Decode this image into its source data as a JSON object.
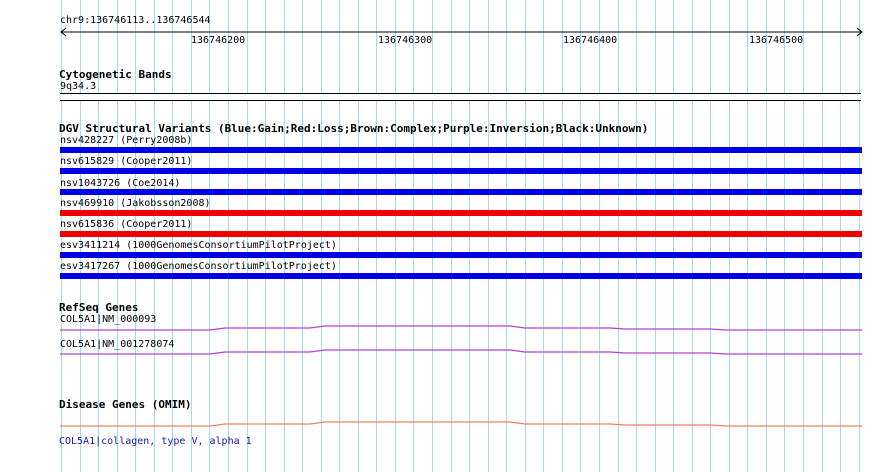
{
  "location": "chr9:136746113..136746544",
  "ruler_ticks": [
    "136746200",
    "136746300",
    "136746400",
    "136746500"
  ],
  "cytoband": {
    "title": "Cytogenetic Bands",
    "band": "9q34.3"
  },
  "dgv": {
    "title": "DGV Structural Variants (Blue:Gain;Red:Loss;Brown:Complex;Purple:Inversion;Black:Unknown)",
    "variants": [
      {
        "label": "nsv428227 (Perry2008b)",
        "type": "Gain",
        "color": "#0000e6"
      },
      {
        "label": "nsv615829 (Cooper2011)",
        "type": "Gain",
        "color": "#0000e6"
      },
      {
        "label": "nsv1043726 (Coe2014)",
        "type": "Gain",
        "color": "#0000e6"
      },
      {
        "label": "nsv469910 (Jakobsson2008)",
        "type": "Loss",
        "color": "#ee0000"
      },
      {
        "label": "nsv615836 (Cooper2011)",
        "type": "Loss",
        "color": "#ee0000"
      },
      {
        "label": "esv3411214 (1000GenomesConsortiumPilotProject)",
        "type": "Gain",
        "color": "#0000e6"
      },
      {
        "label": "esv3417267 (1000GenomesConsortiumPilotProject)",
        "type": "Gain",
        "color": "#0000e6"
      }
    ]
  },
  "refseq": {
    "title": "RefSeq Genes",
    "genes": [
      {
        "label": "COL5A1|NM_000093",
        "color": "#b040d8"
      },
      {
        "label": "COL5A1|NM_001278074",
        "color": "#b040d8"
      }
    ]
  },
  "omim": {
    "title": "Disease Genes (OMIM)",
    "genes": [
      {
        "label": "COL5A1|collagen, type V, alpha 1",
        "color": "#f08060"
      }
    ]
  },
  "colors": {
    "grid": "#a8d8ec",
    "gain": "#0000e6",
    "loss": "#ee0000",
    "refseq": "#b040d8",
    "omim": "#f08060"
  }
}
